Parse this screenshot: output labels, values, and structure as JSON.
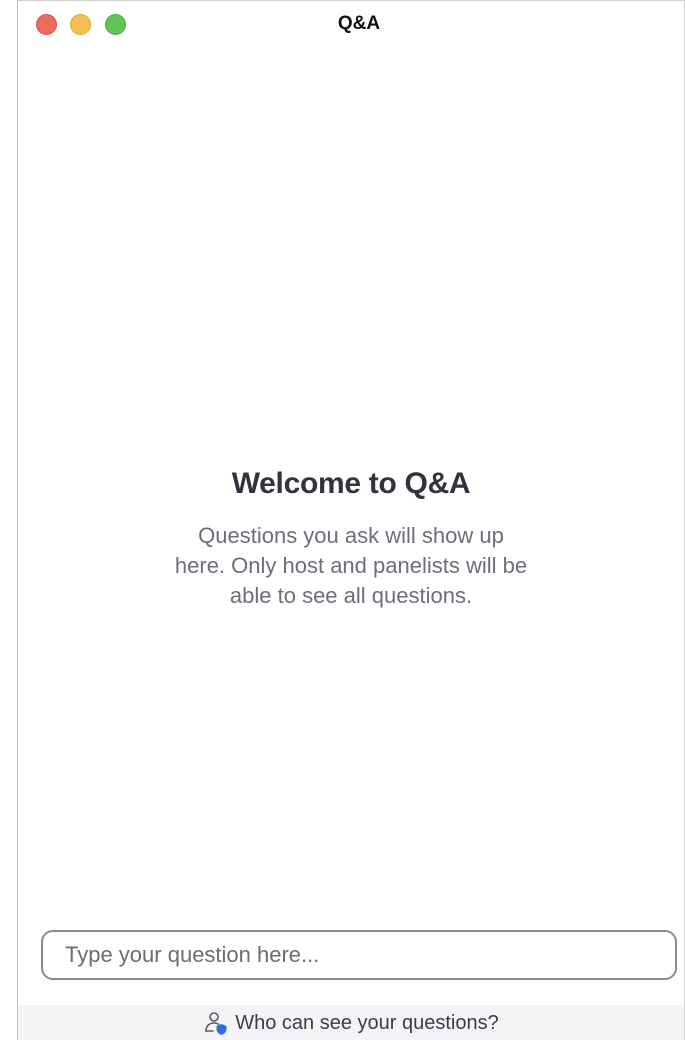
{
  "window": {
    "title": "Q&A"
  },
  "welcome": {
    "title": "Welcome to Q&A",
    "text": "Questions you ask will show up here. Only host and panelists will be able to see all questions."
  },
  "input": {
    "placeholder": "Type your question here..."
  },
  "footer": {
    "link_label": "Who can see your questions?",
    "icon": "person-shield-icon"
  },
  "colors": {
    "close": "#ec6a5e",
    "minimize": "#f4bf4f",
    "maximize": "#61c554",
    "accent": "#2d6ee6"
  }
}
